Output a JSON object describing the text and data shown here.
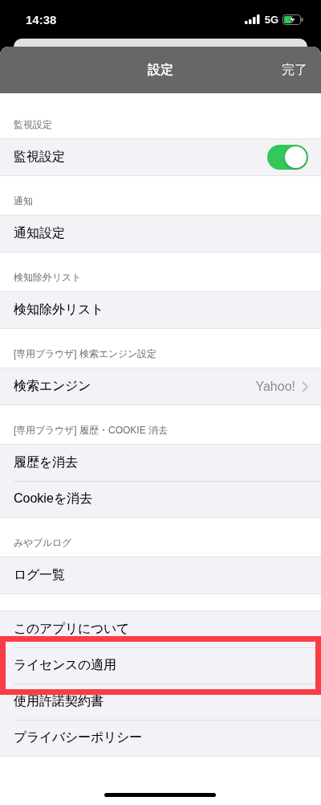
{
  "status_bar": {
    "time": "14:38",
    "network": "5G"
  },
  "nav_bar": {
    "title": "設定",
    "done": "完了"
  },
  "sections": [
    {
      "header": "監視設定",
      "rows": [
        {
          "kind": "toggle",
          "label": "監視設定",
          "on": true,
          "highlighted": false
        }
      ]
    },
    {
      "header": "通知",
      "rows": [
        {
          "kind": "plain",
          "label": "通知設定",
          "highlighted": false
        }
      ]
    },
    {
      "header": "検知除外リスト",
      "rows": [
        {
          "kind": "plain",
          "label": "検知除外リスト",
          "highlighted": false
        }
      ]
    },
    {
      "header": "[専用ブラウザ] 検索エンジン設定",
      "rows": [
        {
          "kind": "detail",
          "label": "検索エンジン",
          "value": "Yahoo!",
          "highlighted": false
        }
      ]
    },
    {
      "header": "[専用ブラウザ] 履歴・COOKIE 消去",
      "rows": [
        {
          "kind": "plain",
          "label": "履歴を消去",
          "highlighted": false
        },
        {
          "kind": "plain",
          "label": "Cookieを消去",
          "highlighted": false
        }
      ]
    },
    {
      "header": "みやブルログ",
      "rows": [
        {
          "kind": "plain",
          "label": "ログ一覧",
          "highlighted": false
        }
      ]
    },
    {
      "rows": [
        {
          "kind": "plain",
          "label": "このアプリについて",
          "highlighted": false
        },
        {
          "kind": "plain",
          "label": "ライセンスの適用",
          "highlighted": true
        },
        {
          "kind": "plain",
          "label": "使用許諾契約書",
          "highlighted": false
        },
        {
          "kind": "plain",
          "label": "プライバシーポリシー",
          "highlighted": false
        }
      ]
    }
  ]
}
